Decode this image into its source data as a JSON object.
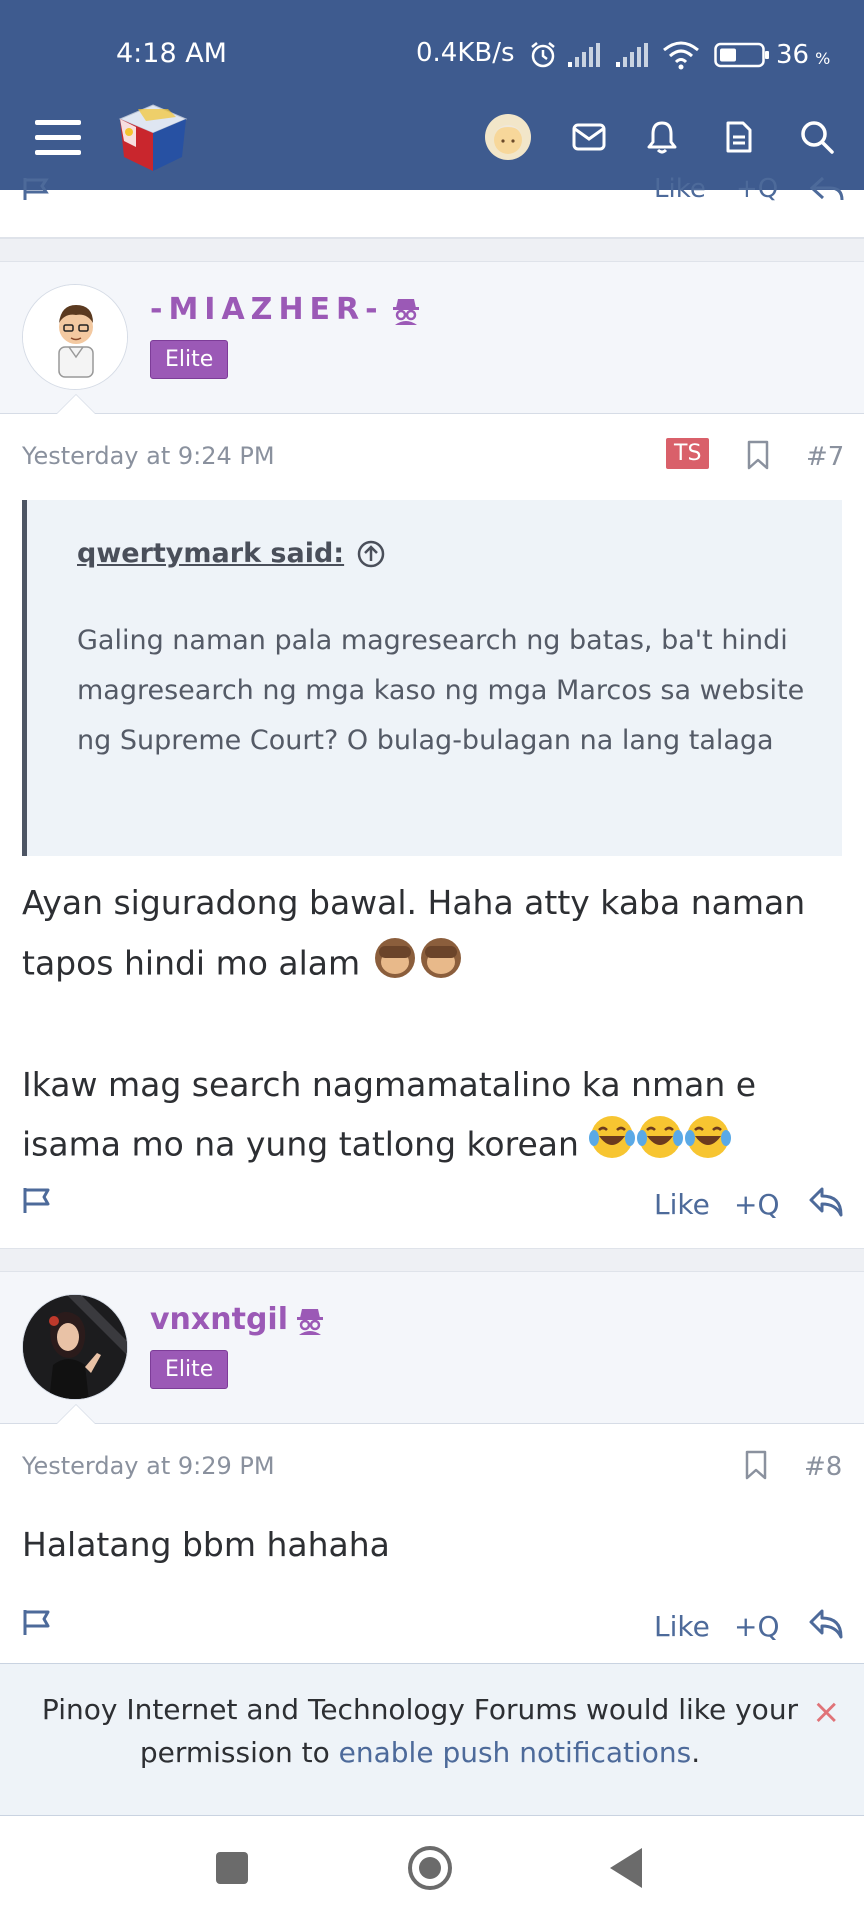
{
  "status_bar": {
    "time": "4:18 AM",
    "net_speed": "0.4KB/s",
    "battery_pct": "36",
    "battery_unit": "%"
  },
  "header": {
    "icons": [
      "menu-icon",
      "site-logo",
      "user-avatar",
      "inbox-icon",
      "alerts-icon",
      "whats-new-icon",
      "search-icon"
    ]
  },
  "prev_post": {
    "like_label": "Like",
    "quote_label": "+Q"
  },
  "posts": [
    {
      "username": "-MIAZHER-",
      "badge": "Elite",
      "date": "Yesterday at 9:24 PM",
      "ts_badge": "TS",
      "number": "#7",
      "quote": {
        "author": "qwertymark said:",
        "text": "Galing naman pala magresearch ng batas, ba't hindi magresearch ng mga kaso ng mga Marcos sa website ng Supreme Court? O bulag-bulagan na lang talaga"
      },
      "body_line1": "Ayan siguradong bawal. Haha atty kaba naman",
      "body_line2": "tapos hindi mo alam",
      "body_line3": "Ikaw mag search nagmamatalino ka nman e",
      "body_line4": "isama mo na yung tatlong korean",
      "actions": {
        "like": "Like",
        "quote": "+Q"
      }
    },
    {
      "username": "vnxntgil",
      "badge": "Elite",
      "date": "Yesterday at 9:29 PM",
      "number": "#8",
      "body_line1": "Halatang bbm hahaha",
      "actions": {
        "like": "Like",
        "quote": "+Q"
      }
    }
  ],
  "push_notice": {
    "text_before": "Pinoy Internet and Technology Forums would like your permission to ",
    "link": "enable push notifications",
    "text_after": ".",
    "close": "×"
  },
  "colors": {
    "header_bg": "#3e5b8f",
    "username": "#9b59b6",
    "elite_badge": "#9b59b6",
    "ts_badge": "#d9606a",
    "link": "#4d6a9a"
  }
}
